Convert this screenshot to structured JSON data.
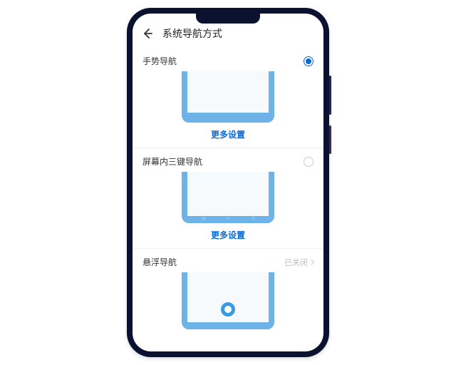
{
  "header": {
    "title": "系统导航方式"
  },
  "options": {
    "gesture": {
      "label": "手势导航",
      "more": "更多设置"
    },
    "threekey": {
      "label": "屏幕内三键导航",
      "more": "更多设置"
    },
    "floating": {
      "label": "悬浮导航",
      "status": "已关闭"
    }
  },
  "colors": {
    "accent": "#0a6bd6"
  }
}
